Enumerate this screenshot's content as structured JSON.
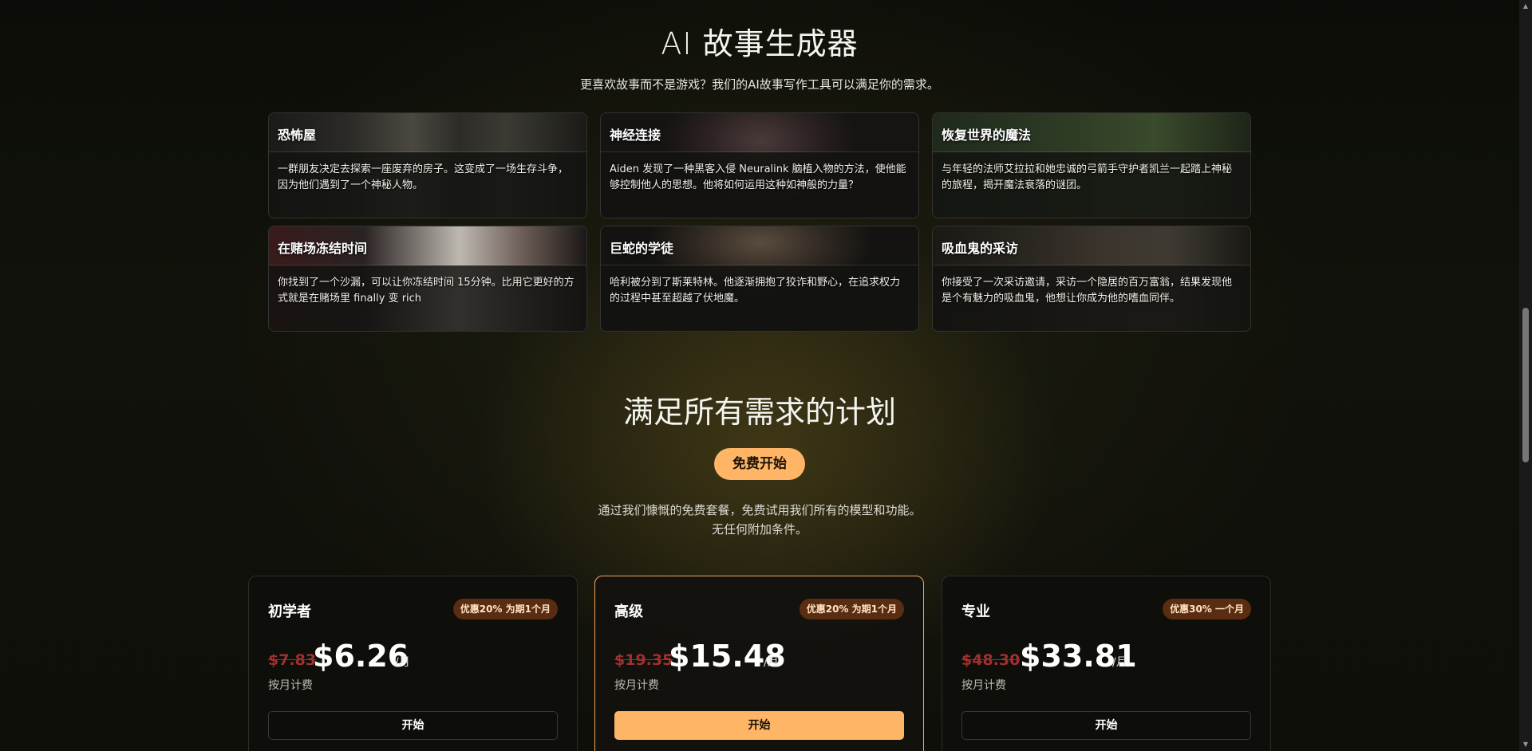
{
  "story_section": {
    "title": "AI 故事生成器",
    "subtitle": "更喜欢故事而不是游戏？我们的AI故事写作工具可以满足你的需求。",
    "cards": [
      {
        "name": "恐怖屋",
        "desc": "一群朋友决定去探索一座废弃的房子。这变成了一场生存斗争，因为他们遇到了一个神秘人物。"
      },
      {
        "name": "神经连接",
        "desc": "Aiden 发现了一种黑客入侵 Neuralink 脑植入物的方法，使他能够控制他人的思想。他将如何运用这种如神般的力量？"
      },
      {
        "name": "恢复世界的魔法",
        "desc": "与年轻的法师艾拉拉和她忠诚的弓箭手守护者凯兰一起踏上神秘的旅程，揭开魔法衰落的谜团。"
      },
      {
        "name": "在赌场冻结时间",
        "desc": "你找到了一个沙漏，可以让你冻结时间 15分钟。比用它更好的方式就是在赌场里 finally 变 rich"
      },
      {
        "name": "巨蛇的学徒",
        "desc": "哈利被分到了斯莱特林。他逐渐拥抱了狡诈和野心，在追求权力的过程中甚至超越了伏地魔。"
      },
      {
        "name": "吸血鬼的采访",
        "desc": "你接受了一次采访邀请，采访一个隐居的百万富翁，结果发现他是个有魅力的吸血鬼，他想让你成为他的嗜血同伴。"
      }
    ]
  },
  "plans_section": {
    "title": "满足所有需求的计划",
    "free_button": "免费开始",
    "free_note_line1": "通过我们慷慨的免费套餐，免费试用我们所有的模型和功能。",
    "free_note_line2": "无任何附加条件。",
    "plans": [
      {
        "name": "初学者",
        "badge": "优惠20% 为期1个月",
        "old_price": "$7.83",
        "price": "$6.26",
        "unit": "/月",
        "billing": "按月计费",
        "cta": "开始"
      },
      {
        "name": "高级",
        "badge": "优惠20% 为期1个月",
        "old_price": "$19.35",
        "price": "$15.48",
        "unit": "/月",
        "billing": "按月计费",
        "cta": "开始"
      },
      {
        "name": "专业",
        "badge": "优惠30% 一个月",
        "old_price": "$48.30",
        "price": "$33.81",
        "unit": "/月",
        "billing": "按月计费",
        "cta": "开始"
      }
    ]
  },
  "colors": {
    "accent": "#ffb566",
    "badge_bg": "#5a2d12",
    "strike_price": "#a0302e"
  },
  "scrollbar": {
    "up_icon": "caret-up-icon",
    "down_icon": "caret-down-icon"
  }
}
